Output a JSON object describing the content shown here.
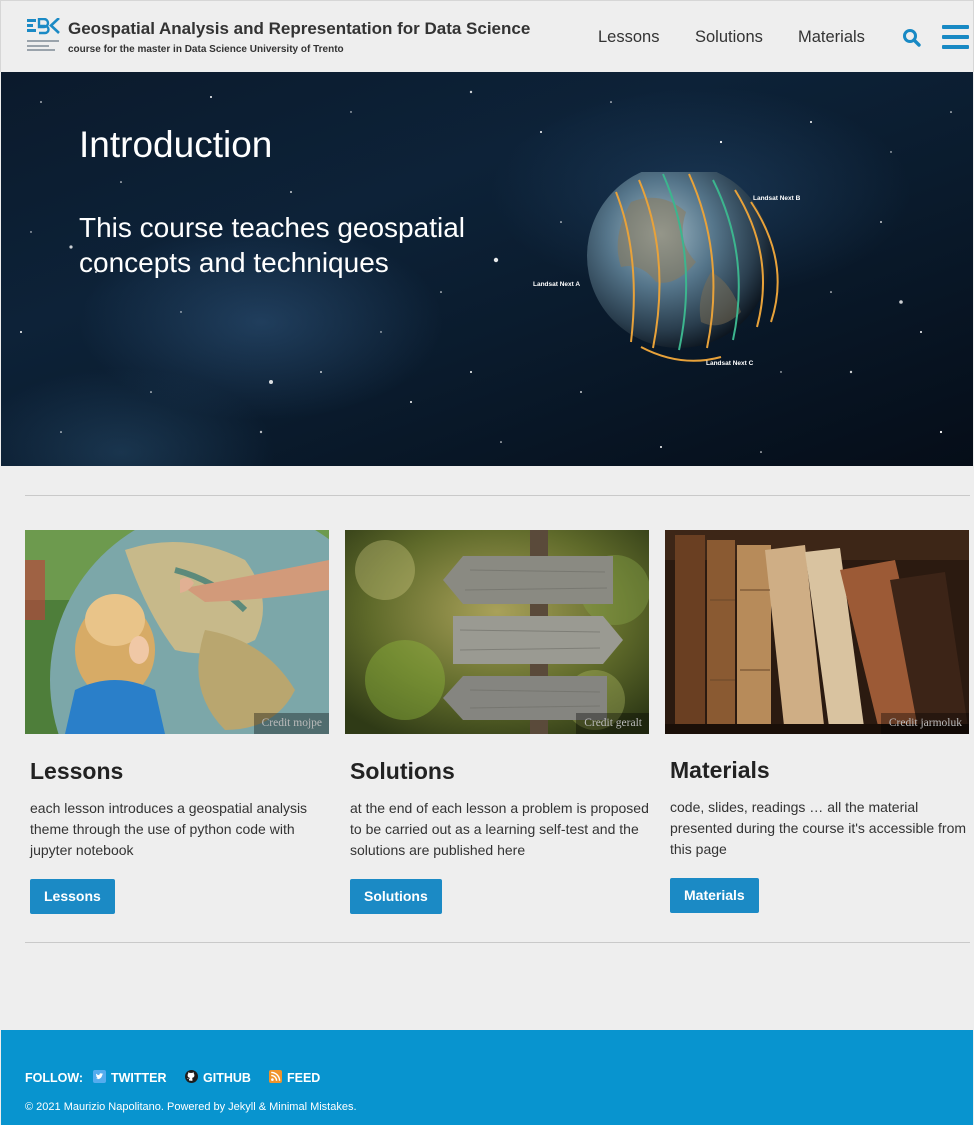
{
  "masthead": {
    "title": "Geospatial Analysis and Representation for Data Science",
    "subtitle": "course for the master in Data Science University of Trento",
    "nav": [
      "Lessons",
      "Solutions",
      "Materials"
    ]
  },
  "hero": {
    "title": "Introduction",
    "excerpt": "This course teaches geospatial concepts and techniques",
    "orbit_labels": [
      "Landsat Next A",
      "Landsat Next B",
      "Landsat Next C"
    ]
  },
  "features": [
    {
      "credit": "Credit mojpe",
      "title": "Lessons",
      "text": "each lesson introduces a geospatial analysis theme through the use of python code with jupyter notebook",
      "button": "Lessons"
    },
    {
      "credit": "Credit geralt",
      "title": "Solutions",
      "text": "at the end of each lesson a problem is proposed to be carried out as a learning self-test and the solutions are published here",
      "button": "Solutions"
    },
    {
      "credit": "Credit jarmoluk",
      "title": "Materials",
      "text": "code, slides, readings … all the material presented during the course it's accessible from this page",
      "button": "Materials"
    }
  ],
  "footer": {
    "follow_label": "FOLLOW:",
    "links": [
      "TWITTER",
      "GITHUB",
      "FEED"
    ],
    "copyright": "© 2021 Maurizio Napolitano. Powered by Jekyll & Minimal Mistakes."
  },
  "colors": {
    "accent": "#1b8ac5",
    "footer": "#0894cf",
    "background": "#eeeeee"
  }
}
